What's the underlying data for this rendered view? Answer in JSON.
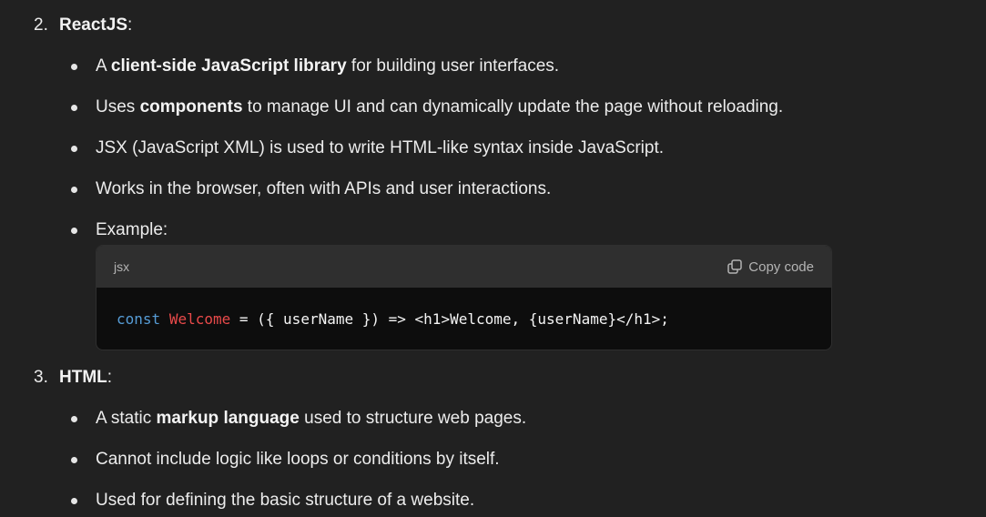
{
  "sections": [
    {
      "number": "2.",
      "title": "ReactJS",
      "suffix": ":",
      "bullets": [
        {
          "pre": "A ",
          "bold": "client-side JavaScript library",
          "post": " for building user interfaces."
        },
        {
          "pre": "Uses ",
          "bold": "components",
          "post": " to manage UI and can dynamically update the page without reloading."
        },
        {
          "pre": "JSX (JavaScript XML) is used to write HTML-like syntax inside JavaScript.",
          "bold": "",
          "post": ""
        },
        {
          "pre": "Works in the browser, often with APIs and user interactions.",
          "bold": "",
          "post": ""
        },
        {
          "pre": "Example:",
          "bold": "",
          "post": ""
        }
      ]
    },
    {
      "number": "3.",
      "title": "HTML",
      "suffix": ":",
      "bullets": [
        {
          "pre": "A static ",
          "bold": "markup language",
          "post": " used to structure web pages."
        },
        {
          "pre": "Cannot include logic like loops or conditions by itself.",
          "bold": "",
          "post": ""
        },
        {
          "pre": "Used for defining the basic structure of a website.",
          "bold": "",
          "post": ""
        }
      ]
    }
  ],
  "code_block": {
    "language": "jsx",
    "copy_label": "Copy code",
    "copy_icon": "copy-icon",
    "tokens": {
      "keyword": "const",
      "name": "Welcome",
      "rest": " = ({ userName }) => <h1>Welcome, {userName}</h1>;"
    }
  },
  "colors": {
    "background": "#212121",
    "code_header": "#2f2f2f",
    "code_body": "#0d0d0d",
    "keyword": "#569cd6",
    "identifier": "#e94a4a"
  }
}
